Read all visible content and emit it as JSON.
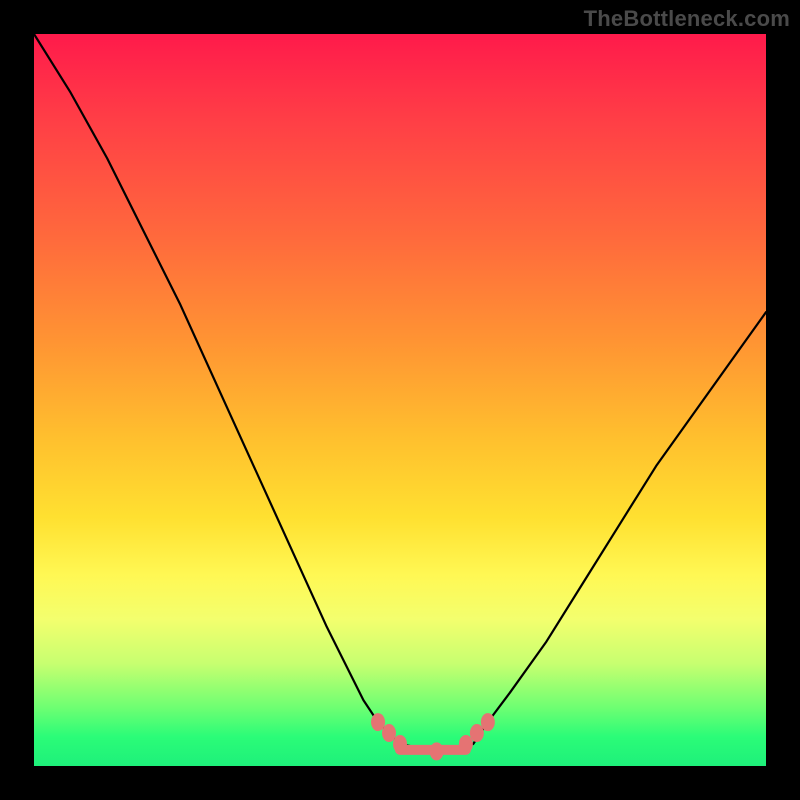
{
  "watermark": "TheBottleneck.com",
  "colors": {
    "page_background": "#000000",
    "curve_stroke": "#000000",
    "marker_fill": "#e57373",
    "gradient_stops": [
      "#ff1a4b",
      "#ff3f46",
      "#ff6a3c",
      "#ff9433",
      "#ffbf2e",
      "#ffe030",
      "#fff854",
      "#f3ff6e",
      "#c7ff70",
      "#6eff72",
      "#2bfc78",
      "#1ef07a"
    ]
  },
  "chart_data": {
    "type": "line",
    "title": "",
    "xlabel": "",
    "ylabel": "",
    "xlim": [
      0,
      100
    ],
    "ylim": [
      0,
      100
    ],
    "grid": false,
    "legend": {
      "visible": false
    },
    "x": [
      0,
      5,
      10,
      15,
      20,
      25,
      30,
      35,
      40,
      45,
      47,
      50,
      55,
      60,
      62,
      65,
      70,
      75,
      80,
      85,
      90,
      95,
      100
    ],
    "values": [
      100,
      92,
      83,
      73,
      63,
      52,
      41,
      30,
      19,
      9,
      6,
      3,
      2,
      3,
      6,
      10,
      17,
      25,
      33,
      41,
      48,
      55,
      62
    ],
    "annotations": {
      "valley_markers_x": [
        47,
        48.5,
        50,
        55,
        59,
        60.5,
        62
      ],
      "valley_markers_y": [
        6,
        4.5,
        3,
        2,
        3,
        4.5,
        6
      ],
      "valley_flat_segment": {
        "x1": 50,
        "x2": 59,
        "y": 2.2
      }
    }
  }
}
